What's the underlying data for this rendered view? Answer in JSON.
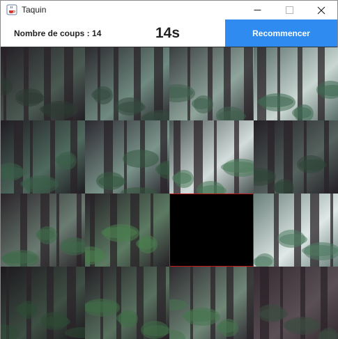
{
  "window": {
    "title": "Taquin",
    "icon": "java-cup-icon"
  },
  "header": {
    "moves_label": "Nombre de coups : ",
    "moves_count": "14",
    "timer": "14s",
    "restart_label": "Recommencer"
  },
  "board": {
    "rows": 4,
    "cols": 4,
    "empty_cell": {
      "row": 2,
      "col": 2
    },
    "theme_colors": {
      "shadow": "#1e1a22",
      "mist": "#b8c8c4",
      "foliage": "#3d6b4a",
      "trunk": "#2a2328"
    }
  }
}
